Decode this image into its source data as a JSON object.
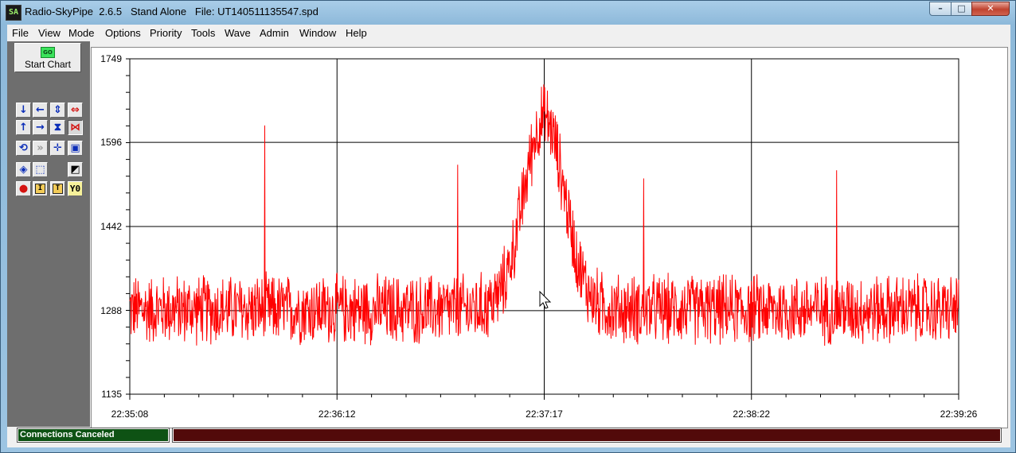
{
  "window": {
    "title": "Radio-SkyPipe  2.6.5   Stand Alone   File: UT140511135547.spd",
    "app_icon_text": "SA",
    "controls": {
      "minimize": "–",
      "maximize": "□",
      "close": "✕"
    }
  },
  "menu": [
    "File",
    "View",
    "Mode",
    "Options",
    "Priority",
    "Tools",
    "Wave",
    "Admin",
    "Window",
    "Help"
  ],
  "toolbar": {
    "start_chart": {
      "icon_text": "GO",
      "label": "Start Chart"
    },
    "icons": [
      "arrow-down-icon",
      "arrow-left-icon",
      "expand-vertical-icon",
      "expand-horizontal-red-icon",
      "arrow-up-icon",
      "arrow-right-icon",
      "compress-vertical-icon",
      "compress-horizontal-red-icon",
      "refresh-icon",
      "fast-forward-icon",
      "crosshair-icon",
      "zoom-box-icon",
      "center-icon",
      "select-box-icon",
      "edit-chart-icon",
      "record-icon",
      "text-insert-icon",
      "text-tool-icon",
      "y-zero-icon"
    ],
    "text_buttons": {
      "text_insert": "I",
      "text_tool": "T",
      "y_zero": "Y0"
    }
  },
  "status": {
    "connection": "Connections Canceled"
  },
  "chart_data": {
    "type": "line",
    "title": "",
    "xlabel": "",
    "ylabel": "",
    "series_color": "#ff0000",
    "ylim": [
      1135,
      1749
    ],
    "y_ticks": [
      "1749",
      "1596",
      "1442",
      "1288",
      "1135"
    ],
    "x_ticks": [
      "22:35:08",
      "22:36:12",
      "22:37:17",
      "22:38:22",
      "22:39:26"
    ],
    "x_range_seconds": [
      0,
      258
    ],
    "grid": true,
    "noise_baseline": 1290,
    "noise_range": [
      1215,
      1360
    ],
    "peak": {
      "time": "22:37:17",
      "value": 1640
    },
    "spikes": [
      {
        "time": "22:35:50",
        "value": 1627
      },
      {
        "time": "22:36:50",
        "value": 1555
      },
      {
        "time": "22:37:48",
        "value": 1530
      },
      {
        "time": "22:38:48",
        "value": 1545
      }
    ]
  }
}
